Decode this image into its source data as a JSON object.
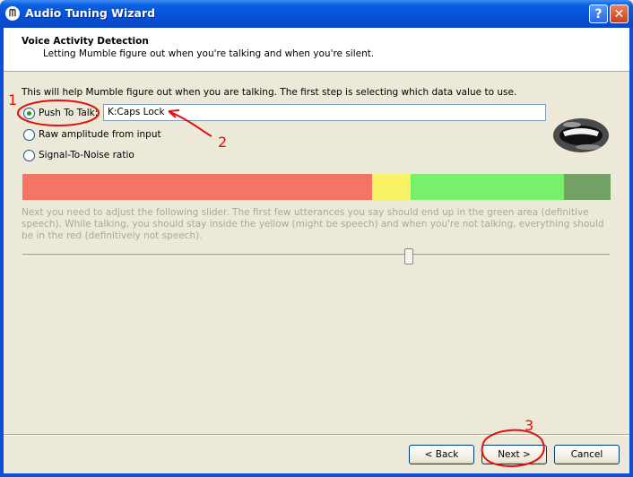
{
  "window": {
    "title": "Audio Tuning Wizard",
    "help_label": "?",
    "close_label": "✕",
    "icon": "mumble-icon"
  },
  "header": {
    "title": "Voice Activity Detection",
    "subtitle": "Letting Mumble figure out when you're talking and when you're silent."
  },
  "intro": "This will help Mumble figure out when you are talking. The first step is selecting which data value to use.",
  "options": [
    {
      "label": "Push To Talk:",
      "checked": true
    },
    {
      "label": "Raw amplitude from input",
      "checked": false
    },
    {
      "label": "Signal-To-Noise ratio",
      "checked": false
    }
  ],
  "push_to_talk_value": "K:Caps Lock",
  "meter_colors": {
    "red": "#f47466",
    "yellow": "#f7f266",
    "green": "#78f06c",
    "dark_green": "#74a266"
  },
  "description": "Next you need to adjust the following slider. The first few utterances you say should end up in the green area (definitive speech). While talking, you should stay inside the yellow (might be speech) and when you're not talking, everything should be in the red (definitively not speech).",
  "slider_value_fraction": 0.66,
  "buttons": {
    "back": "< Back",
    "next": "Next >",
    "cancel": "Cancel"
  },
  "annotations": [
    "1",
    "2",
    "3"
  ]
}
